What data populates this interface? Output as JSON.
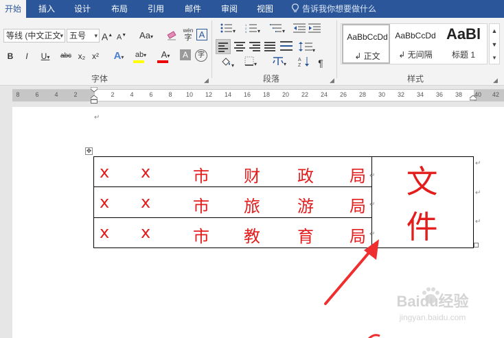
{
  "tabs": [
    "开始",
    "插入",
    "设计",
    "布局",
    "引用",
    "邮件",
    "审阅",
    "视图"
  ],
  "tell_me": "告诉我你想要做什么",
  "font_group": {
    "font_name": "等线 (中文正文",
    "font_size": "五号",
    "grow": "A",
    "shrink": "A",
    "change_case": "Aa",
    "phonetic": "wén",
    "char_border": "A",
    "bold": "B",
    "italic": "I",
    "underline": "U",
    "strike": "abc",
    "subscript": "x₂",
    "superscript": "x²",
    "text_effects": "A",
    "highlight": "ab",
    "font_color": "A",
    "char_shading": "A",
    "enclose": "字",
    "label": "字体"
  },
  "paragraph_group": {
    "label": "段落"
  },
  "styles_group": {
    "label": "样式",
    "items": [
      {
        "preview": "AaBbCcDd",
        "name": "↲ 正文"
      },
      {
        "preview": "AaBbCcDd",
        "name": "↲ 无间隔"
      },
      {
        "preview": "AaBl",
        "name": "标题 1"
      }
    ]
  },
  "ruler_ticks": [
    "8",
    "6",
    "4",
    "2",
    "2",
    "4",
    "6",
    "8",
    "10",
    "12",
    "14",
    "16",
    "18",
    "20",
    "22",
    "24",
    "26",
    "28",
    "30",
    "32",
    "34",
    "36",
    "38",
    "40",
    "42"
  ],
  "document": {
    "paragraph_mark": "↵",
    "rows": [
      [
        "x",
        "x",
        "市",
        "财",
        "政",
        "局"
      ],
      [
        "x",
        "x",
        "市",
        "旅",
        "游",
        "局"
      ],
      [
        "x",
        "x",
        "市",
        "教",
        "育",
        "局"
      ]
    ],
    "merged_cell": "文件"
  },
  "watermark": {
    "brand": "Baidu经验",
    "url": "jingyan.baidu.com"
  },
  "colors": {
    "accent": "#2b579a",
    "doc_text": "#e31c1c",
    "arrow": "#ef2f2f"
  }
}
